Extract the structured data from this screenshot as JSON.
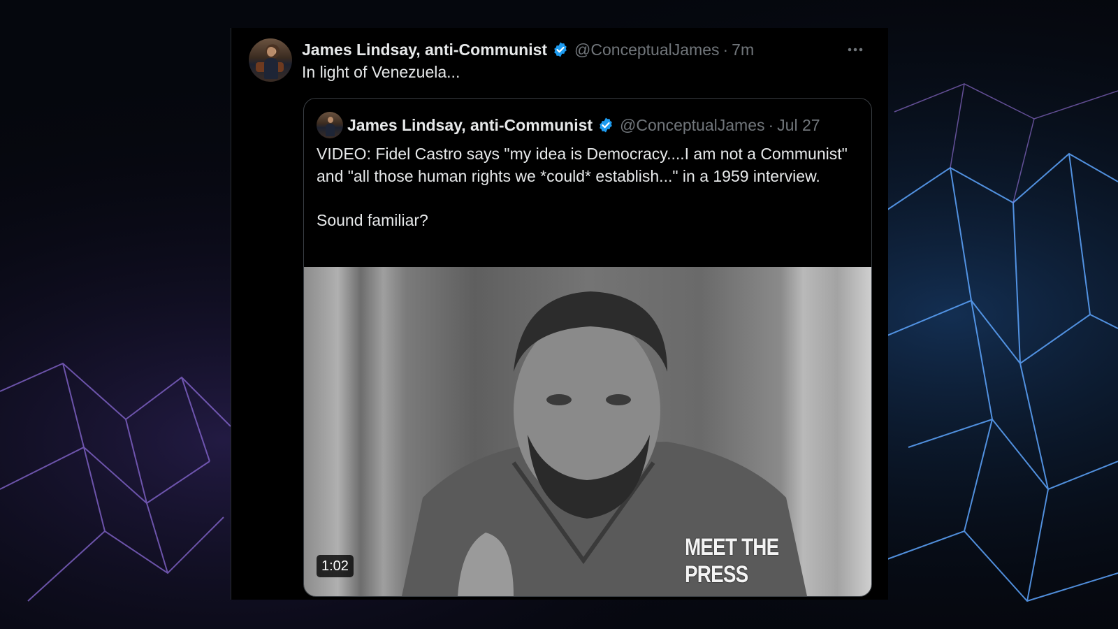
{
  "tweet": {
    "author_name": "James Lindsay, anti-Communist",
    "handle": "@ConceptualJames",
    "separator": "·",
    "time": "7m",
    "text": "In light of Venezuela..."
  },
  "quoted_tweet": {
    "author_name": "James Lindsay, anti-Communist",
    "handle": "@ConceptualJames",
    "separator": "·",
    "time": "Jul 27",
    "text": "VIDEO: Fidel Castro says \"my idea is Democracy....I am not a Communist\" and \"all those human rights we *could* establish...\" in a 1959 interview.\n\nSound familiar?",
    "video": {
      "duration": "1:02",
      "watermark": "MEET THE PRESS"
    }
  },
  "colors": {
    "verified_badge": "#1d9bf0",
    "text_primary": "#e7e9ea",
    "text_secondary": "#71767b",
    "card_background": "#000000"
  }
}
